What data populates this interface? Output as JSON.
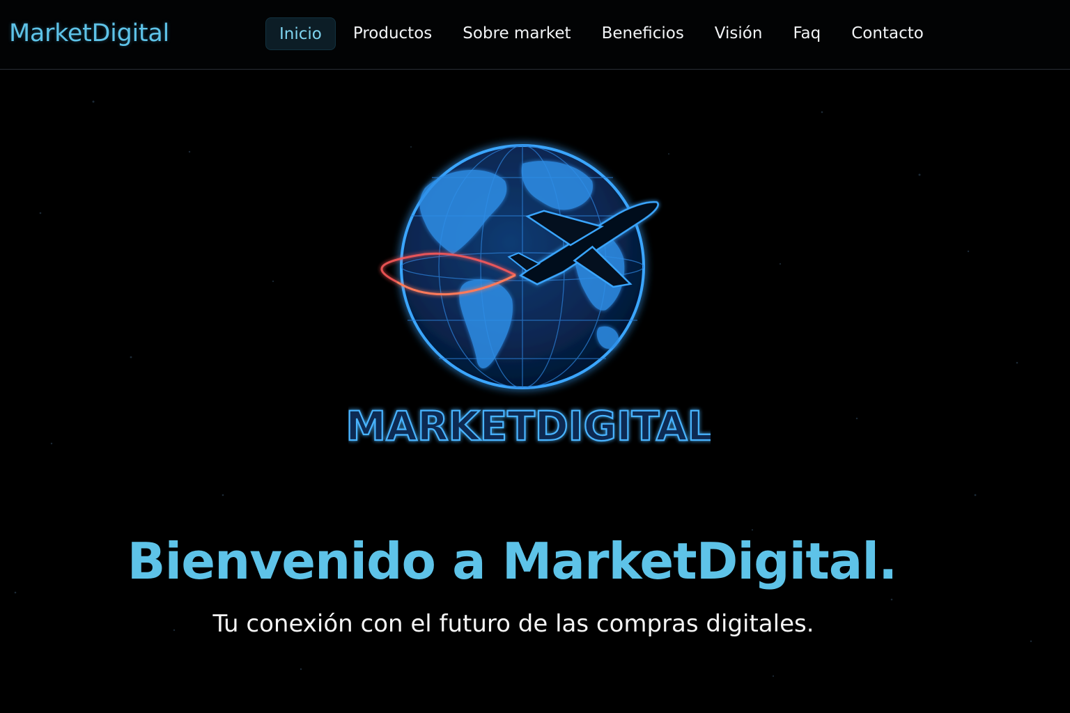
{
  "navbar": {
    "brand": "MarketDigital",
    "links": [
      {
        "label": "Inicio",
        "active": true
      },
      {
        "label": "Productos",
        "active": false
      },
      {
        "label": "Sobre market",
        "active": false
      },
      {
        "label": "Beneficios",
        "active": false
      },
      {
        "label": "Visión",
        "active": false
      },
      {
        "label": "Faq",
        "active": false
      },
      {
        "label": "Contacto",
        "active": false
      }
    ]
  },
  "hero": {
    "logo_text": "MARKETDIGITAL",
    "logo_icons": [
      "globe-icon",
      "airplane-icon",
      "orbit-trail-icon"
    ],
    "title": "Bienvenido a MarketDigital.",
    "subtitle": "Tu conexión con el futuro de las compras digitales."
  },
  "colors": {
    "background": "#000000",
    "accent": "#5ec3e8",
    "globe_glow": "#2a8cff",
    "orbit_trail": "#ff5a5a"
  }
}
